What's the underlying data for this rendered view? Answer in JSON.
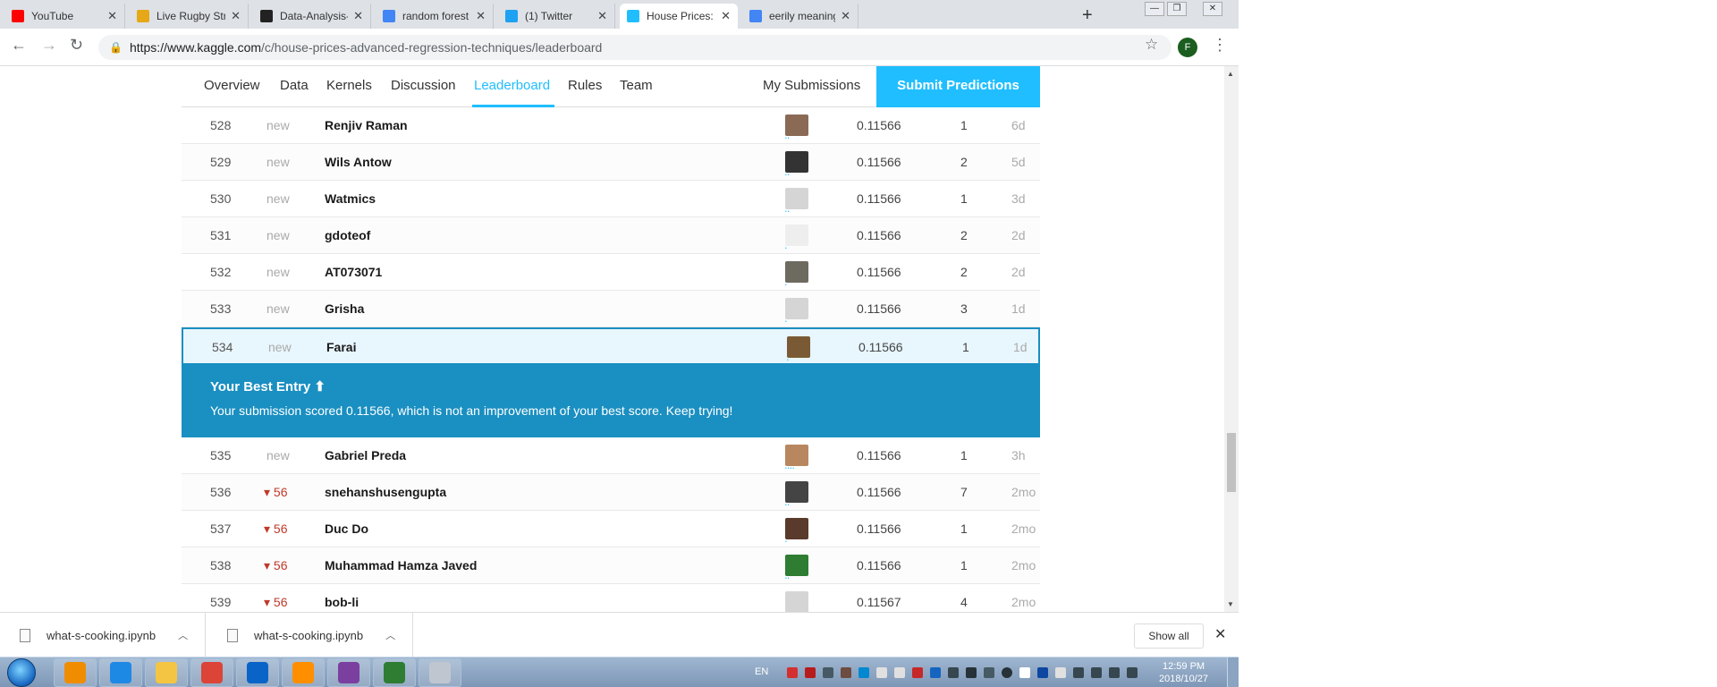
{
  "browser": {
    "tabs": [
      {
        "label": "YouTube",
        "favicon": "youtube-icon",
        "color": "#ff0000"
      },
      {
        "label": "Live Rugby Streami",
        "favicon": "trophy-icon",
        "color": "#e6a817"
      },
      {
        "label": "Data-Analysis-Proje",
        "favicon": "github-icon",
        "color": "#222222"
      },
      {
        "label": "random forest - Go",
        "favicon": "google-icon",
        "color": "#4285f4"
      },
      {
        "label": "(1) Twitter",
        "favicon": "twitter-icon",
        "color": "#1da1f2"
      },
      {
        "label": "House Prices: Adva",
        "favicon": "kaggle-icon",
        "color": "#20beff"
      },
      {
        "label": "eerily meaning - Go",
        "favicon": "google-icon",
        "color": "#4285f4"
      }
    ],
    "close_glyph": "✕",
    "new_tab_glyph": "+",
    "url_host": "https://www.kaggle.com",
    "url_path": "/c/house-prices-advanced-regression-techniques/leaderboard",
    "profile_initial": "F"
  },
  "competition_nav": {
    "links": [
      "Overview",
      "Data",
      "Kernels",
      "Discussion",
      "Leaderboard",
      "Rules",
      "Team"
    ],
    "active": "Leaderboard",
    "my_submissions": "My Submissions",
    "submit": "Submit Predictions"
  },
  "leaderboard": {
    "rows_before": [
      {
        "rank": "528",
        "change": "new",
        "team": "Renjiv Raman",
        "score": "0.11566",
        "entries": "1",
        "last": "6d",
        "avatar_color": "#8a6a55",
        "tier": "••"
      },
      {
        "rank": "529",
        "change": "new",
        "team": "Wils Antow",
        "score": "0.11566",
        "entries": "2",
        "last": "5d",
        "avatar_color": "#333333",
        "tier": "••"
      },
      {
        "rank": "530",
        "change": "new",
        "team": "Watmics",
        "score": "0.11566",
        "entries": "1",
        "last": "3d",
        "avatar_color": "#d5d5d5",
        "tier": "••"
      },
      {
        "rank": "531",
        "change": "new",
        "team": "gdoteof",
        "score": "0.11566",
        "entries": "2",
        "last": "2d",
        "avatar_color": "#eeeeee",
        "tier": "•"
      },
      {
        "rank": "532",
        "change": "new",
        "team": "AT073071",
        "score": "0.11566",
        "entries": "2",
        "last": "2d",
        "avatar_color": "#6d6a60",
        "tier": "•"
      },
      {
        "rank": "533",
        "change": "new",
        "team": "Grisha",
        "score": "0.11566",
        "entries": "3",
        "last": "1d",
        "avatar_color": "#d5d5d5",
        "tier": "•"
      }
    ],
    "my_row": {
      "rank": "534",
      "change": "new",
      "team": "Farai",
      "score": "0.11566",
      "entries": "1",
      "last": "1d",
      "avatar_color": "#7a5a35",
      "tier": "•"
    },
    "best_entry": {
      "title": "Your Best Entry ⬆",
      "message": "Your submission scored 0.11566, which is not an improvement of your best score. Keep trying!"
    },
    "rows_after": [
      {
        "rank": "535",
        "change": "new",
        "change_dir": "none",
        "team": "Gabriel Preda",
        "score": "0.11566",
        "entries": "1",
        "last": "3h",
        "avatar_color": "#b8875f",
        "tier": "••••"
      },
      {
        "rank": "536",
        "change": "▾ 56",
        "change_dir": "down",
        "team": "snehanshusengupta",
        "score": "0.11566",
        "entries": "7",
        "last": "2mo",
        "avatar_color": "#444444",
        "tier": "••"
      },
      {
        "rank": "537",
        "change": "▾ 56",
        "change_dir": "down",
        "team": "Duc Do",
        "score": "0.11566",
        "entries": "1",
        "last": "2mo",
        "avatar_color": "#5a3a2a",
        "tier": "•"
      },
      {
        "rank": "538",
        "change": "▾ 56",
        "change_dir": "down",
        "team": "Muhammad Hamza Javed",
        "score": "0.11566",
        "entries": "1",
        "last": "2mo",
        "avatar_color": "#2e7d32",
        "tier": "••"
      },
      {
        "rank": "539",
        "change": "▾ 56",
        "change_dir": "down",
        "team": "bob-li",
        "score": "0.11567",
        "entries": "4",
        "last": "2mo",
        "avatar_color": "#d5d5d5",
        "tier": "•"
      }
    ]
  },
  "downloads": {
    "items": [
      {
        "filename": "what-s-cooking.ipynb"
      },
      {
        "filename": "what-s-cooking.ipynb"
      }
    ],
    "show_all": "Show all"
  },
  "taskbar": {
    "apps": [
      {
        "name": "vlc-icon",
        "color": "#f08c00"
      },
      {
        "name": "internet-explorer-icon",
        "color": "#1e88e5"
      },
      {
        "name": "file-explorer-icon",
        "color": "#f4c542"
      },
      {
        "name": "chrome-icon",
        "color": "#db4437"
      },
      {
        "name": "outlook-icon",
        "color": "#0a64c8"
      },
      {
        "name": "media-player-icon",
        "color": "#ff8f00"
      },
      {
        "name": "cat-app-icon",
        "color": "#7b3fa0"
      },
      {
        "name": "chart-app-icon",
        "color": "#2e7d32"
      },
      {
        "name": "paint-icon",
        "color": "#c0c6d0"
      }
    ],
    "language": "EN",
    "time": "12:59 PM",
    "date": "2018/10/27"
  }
}
